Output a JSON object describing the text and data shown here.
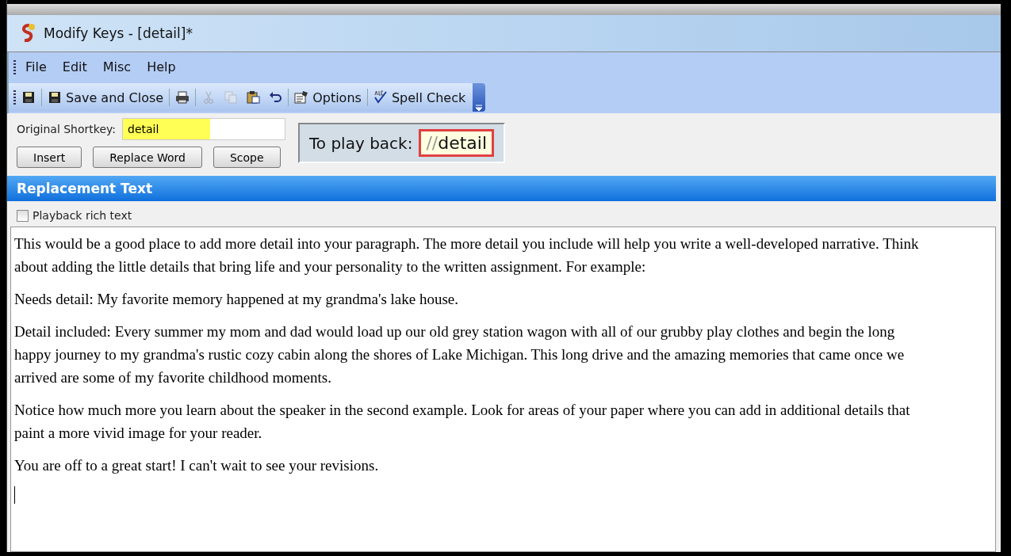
{
  "window": {
    "title": "Modify Keys - [detail]*"
  },
  "menu": [
    "File",
    "Edit",
    "Misc",
    "Help"
  ],
  "toolbar": [
    {
      "kind": "save",
      "disabled": false
    },
    {
      "kind": "sep"
    },
    {
      "kind": "save",
      "label": "Save and Close",
      "disabled": false
    },
    {
      "kind": "sep"
    },
    {
      "kind": "print",
      "disabled": false
    },
    {
      "kind": "sep"
    },
    {
      "kind": "cut",
      "disabled": true
    },
    {
      "kind": "copy",
      "disabled": true
    },
    {
      "kind": "paste",
      "disabled": false
    },
    {
      "kind": "undo",
      "disabled": false
    },
    {
      "kind": "sep"
    },
    {
      "kind": "options",
      "label": "Options",
      "disabled": false
    },
    {
      "kind": "sep"
    },
    {
      "kind": "spell",
      "label": "Spell Check",
      "disabled": false
    }
  ],
  "shortkey": {
    "label": "Original Shortkey:",
    "value": "detail",
    "highlighted": true
  },
  "buttons": [
    "Insert",
    "Replace Word",
    "Scope"
  ],
  "playback": {
    "label": "To play back:",
    "prefix": "//",
    "key": "detail"
  },
  "section_title": "Replacement Text",
  "rich_text": {
    "label": "Playback rich text",
    "checked": false
  },
  "paragraphs": [
    "This would be a good place to add more detail into your paragraph. The more detail you include will help you write a well-developed narrative. Think about adding the little details that bring life and your personality to the written assignment. For example:",
    "Needs detail: My favorite memory happened at my grandma's lake house.",
    "Detail included: Every summer my mom and dad would load up our old grey station wagon with all of our grubby play clothes and begin the long happy journey to my grandma's rustic cozy cabin along the shores of Lake Michigan.  This long drive and the amazing memories that came once we arrived are some of my favorite childhood moments.",
    "Notice how much more you learn about the speaker in the second example. Look for areas of your paper where you can add in additional details that paint a more vivid image for your reader.",
    "You are off to a great start! I can't wait to see your revisions."
  ]
}
